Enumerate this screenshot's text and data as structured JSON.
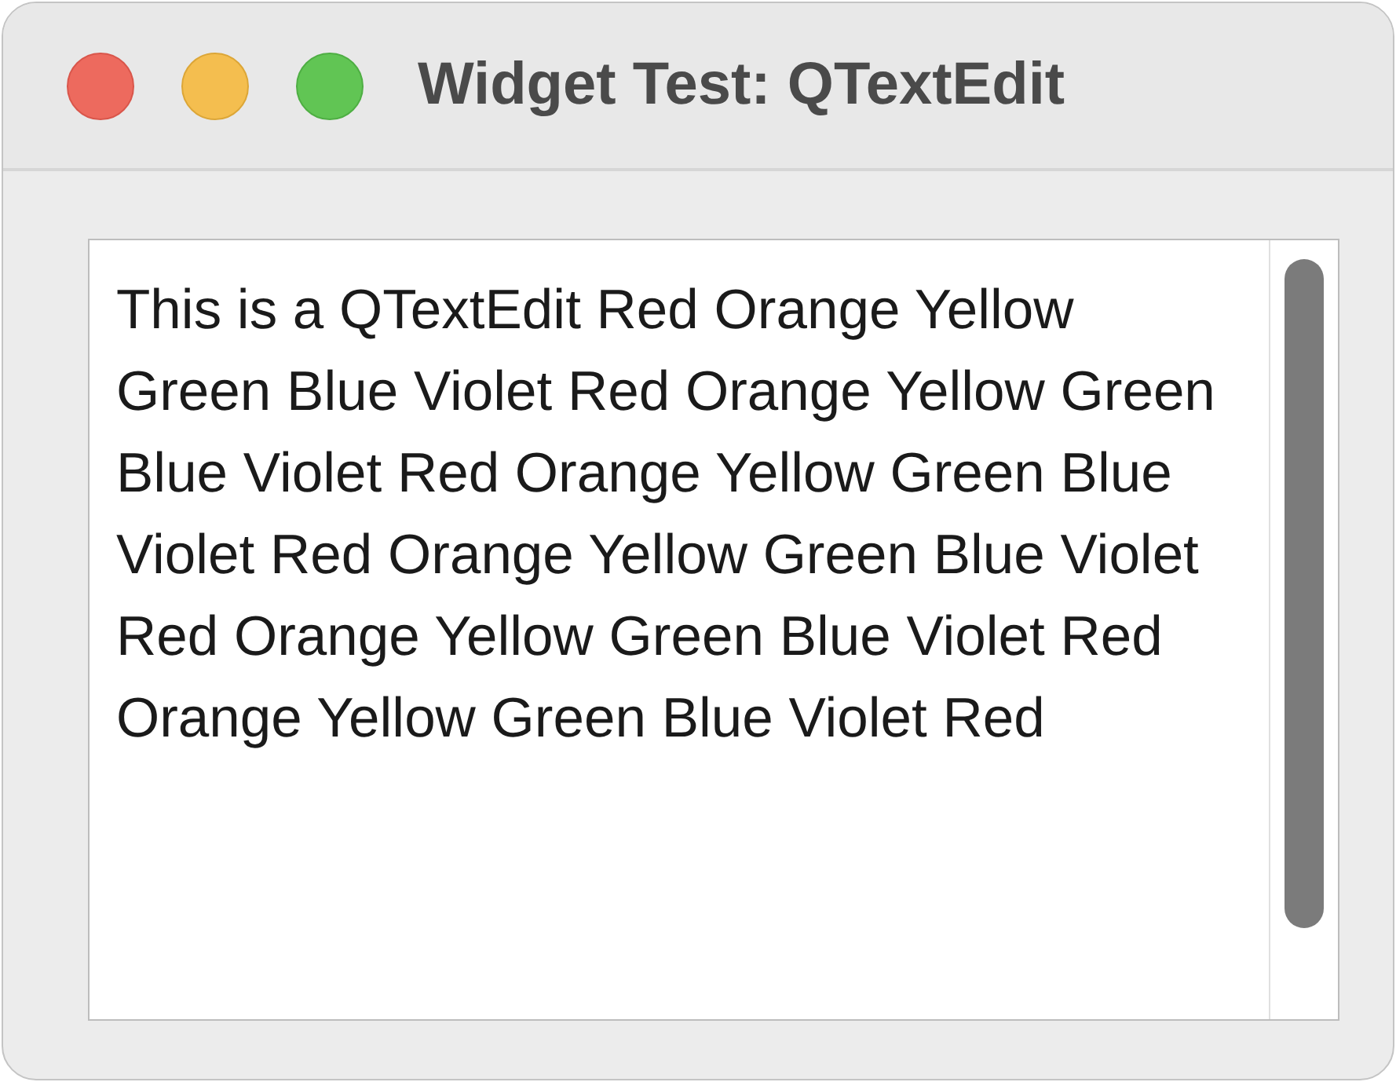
{
  "window": {
    "title": "Widget Test: QTextEdit"
  },
  "text_edit": {
    "value": "This is a QTextEdit Red Orange Yellow Green Blue Violet Red Orange Yellow Green Blue Violet Red Orange Yellow Green Blue Violet Red Orange Yellow Green Blue Violet Red Orange Yellow Green Blue Violet Red Orange Yellow Green Blue Violet Red"
  }
}
